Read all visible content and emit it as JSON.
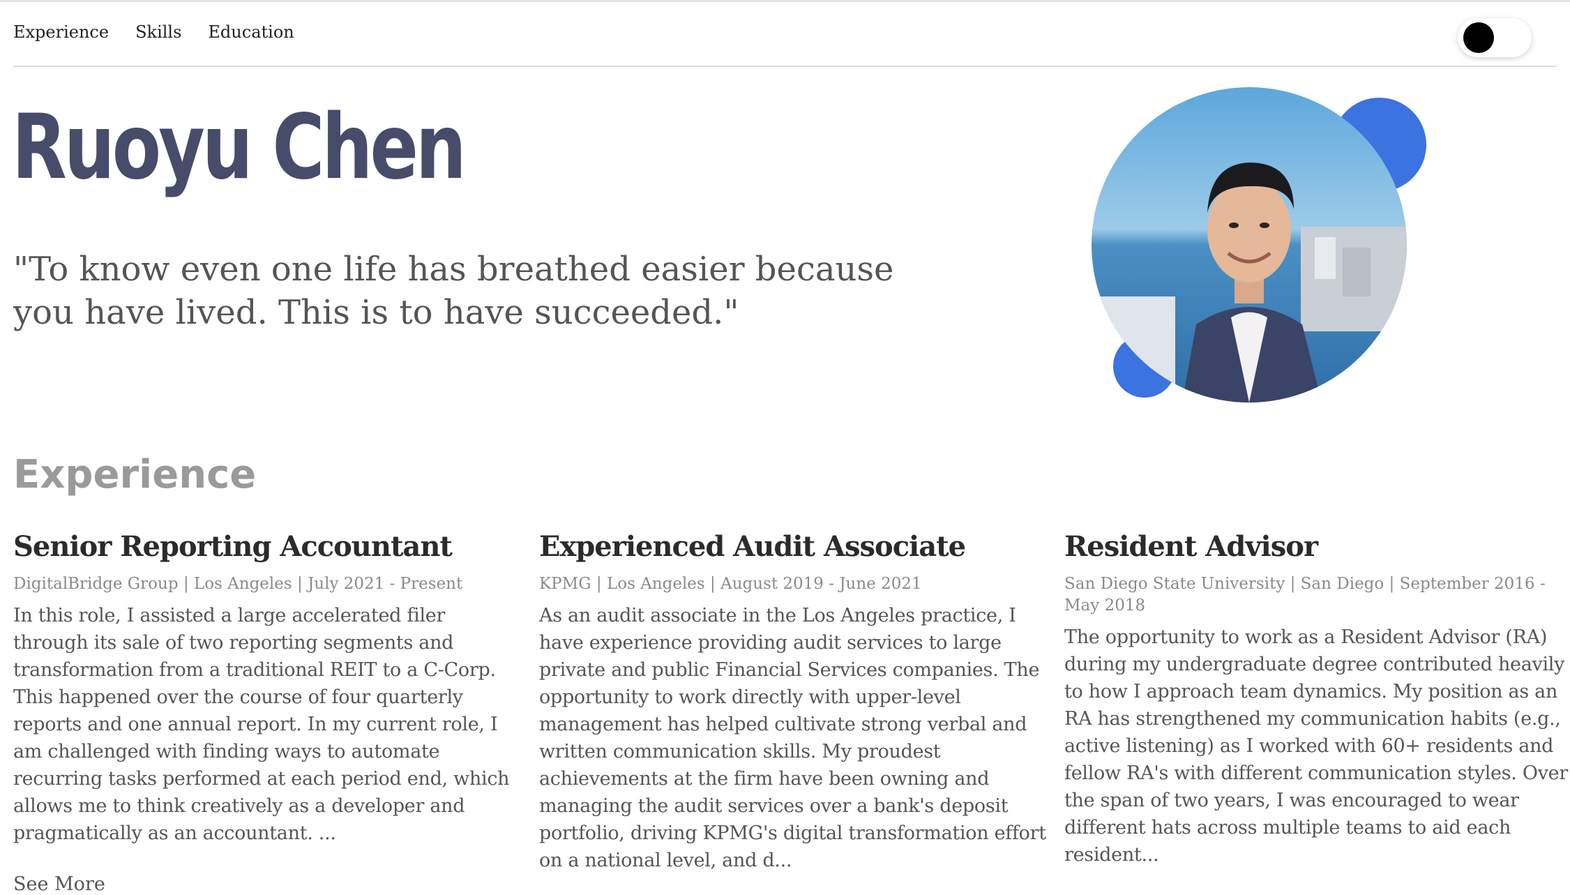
{
  "nav": {
    "links": [
      "Experience",
      "Skills",
      "Education"
    ]
  },
  "theme_toggle": {
    "state": "dark knob left"
  },
  "hero": {
    "name": "Ruoyu Chen",
    "quote": "\"To know even one life has breathed easier because you have lived. This is to have succeeded.\""
  },
  "colors": {
    "accent_blue": "#3b73e0",
    "name_color": "#474c6b",
    "section_title_color": "#9a9a9a"
  },
  "experience": {
    "title": "Experience",
    "jobs": [
      {
        "title": "Senior Reporting Accountant",
        "meta": "DigitalBridge Group | Los Angeles | July 2021 - Present",
        "description": "In this role, I assisted a large accelerated filer through its sale of two reporting segments and transformation from a traditional REIT to a C-Corp. This happened over the course of four quarterly reports and one annual report. In my current role, I am challenged with finding ways to automate recurring tasks performed at each period end, which allows me to think creatively as a developer and pragmatically as an accountant. ...",
        "see_more": "See More"
      },
      {
        "title": "Experienced Audit Associate",
        "meta": "KPMG | Los Angeles | August 2019 - June 2021",
        "description": "As an audit associate in the Los Angeles practice, I have experience providing audit services to large private and public Financial Services companies. The opportunity to work directly with upper-level management has helped cultivate strong verbal and written communication skills. My proudest achievements at the firm have been owning and managing the audit services over a bank's deposit portfolio, driving KPMG's digital transformation effort on a national level, and d..."
      },
      {
        "title": "Resident Advisor",
        "meta": "San Diego State University | San Diego | September 2016 - May 2018",
        "description": "The opportunity to work as a Resident Advisor (RA) during my undergraduate degree contributed heavily to how I approach team dynamics. My position as an RA has strengthened my communication habits (e.g., active listening) as I worked with 60+ residents and fellow RA's with different communication styles. Over the span of two years, I was encouraged to wear different hats across multiple teams to aid each resident..."
      }
    ]
  }
}
